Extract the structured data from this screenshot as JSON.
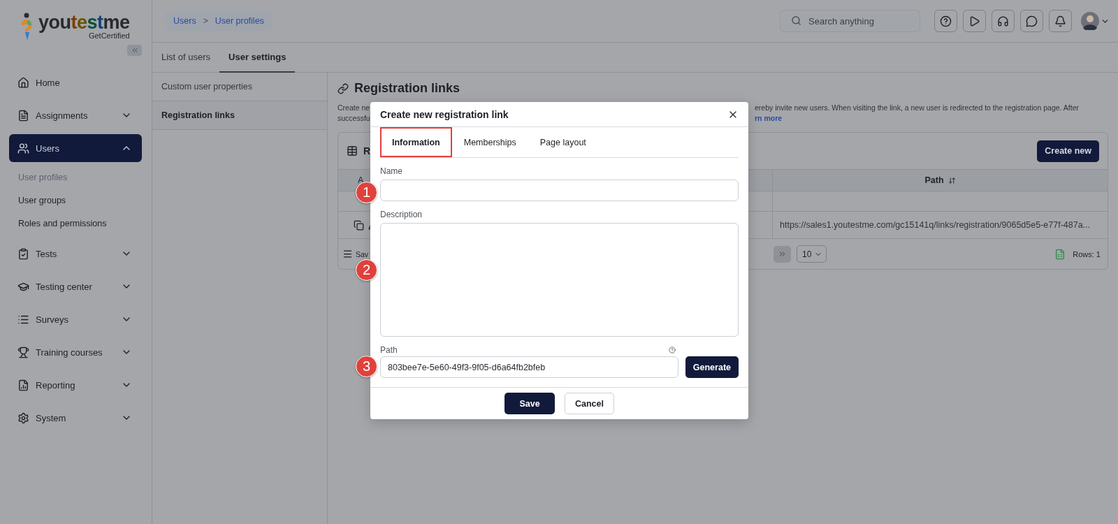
{
  "sidebar": {
    "logo": {
      "wordmark": "youtestme",
      "tagline": "GetCertified"
    },
    "items": [
      {
        "label": "Home",
        "expandable": false,
        "selected": false
      },
      {
        "label": "Assignments",
        "expandable": true,
        "expanded": false,
        "selected": false
      },
      {
        "label": "Users",
        "expandable": true,
        "expanded": true,
        "selected": true,
        "children": [
          {
            "label": "User profiles",
            "selected": true
          },
          {
            "label": "User groups",
            "selected": false
          },
          {
            "label": "Roles and permissions",
            "selected": false
          }
        ]
      },
      {
        "label": "Tests",
        "expandable": true,
        "expanded": false,
        "selected": false
      },
      {
        "label": "Testing center",
        "expandable": true,
        "expanded": false,
        "selected": false
      },
      {
        "label": "Surveys",
        "expandable": true,
        "expanded": false,
        "selected": false
      },
      {
        "label": "Training courses",
        "expandable": true,
        "expanded": false,
        "selected": false
      },
      {
        "label": "Reporting",
        "expandable": true,
        "expanded": false,
        "selected": false
      },
      {
        "label": "System",
        "expandable": true,
        "expanded": false,
        "selected": false
      }
    ]
  },
  "header": {
    "breadcrumb": [
      "Users",
      "User profiles"
    ],
    "separator": ">",
    "search": {
      "placeholder": "Search anything"
    }
  },
  "page_tabs": [
    {
      "label": "List of users",
      "selected": false
    },
    {
      "label": "User settings",
      "selected": true
    }
  ],
  "settings_menu": [
    {
      "label": "Custom user properties",
      "selected": false
    },
    {
      "label": "Registration links",
      "selected": true
    }
  ],
  "content": {
    "title": "Registration links",
    "description": {
      "line_1": {
        "start": "Create ne",
        "end": "ereby invite new users. When visiting the link, a new user is redirected to the registration page. After"
      },
      "line_2": {
        "start": "successfu",
        "link": "rn more"
      }
    },
    "table": {
      "title": "R",
      "create_button": "Create new",
      "columns": [
        "A",
        "Path"
      ],
      "rows": [
        {
          "path": "https://sales1.youtestme.com/gc15141q/links/registration/9065d5e5-e77f-487a..."
        }
      ],
      "footer": {
        "menu_label": "Sav",
        "page_size": "10",
        "rows_count": "Rows: 1"
      }
    }
  },
  "dialog": {
    "title": "Create new registration link",
    "tabs": [
      {
        "label": "Information",
        "selected": true,
        "highlighted": true
      },
      {
        "label": "Memberships",
        "selected": false,
        "highlighted": false
      },
      {
        "label": "Page layout",
        "selected": false,
        "highlighted": false
      }
    ],
    "name": {
      "label": "Name",
      "marker": "1"
    },
    "description": {
      "label": "Description",
      "marker": "2"
    },
    "path": {
      "label": "Path",
      "value": "803bee7e-5e60-49f3-9f05-d6a64fb2bfeb",
      "marker": "3",
      "generate_button": "Generate"
    },
    "save_button": "Save",
    "cancel_button": "Cancel"
  }
}
